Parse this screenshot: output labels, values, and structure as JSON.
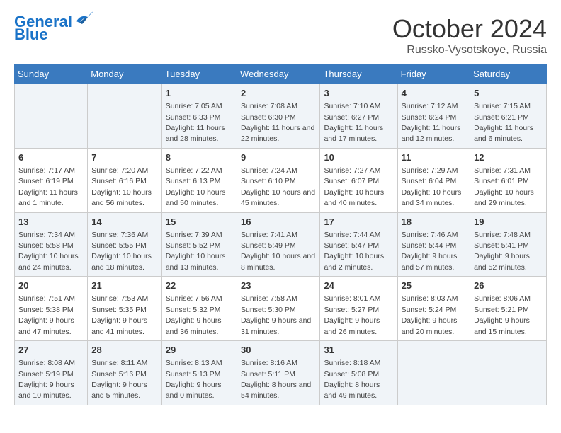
{
  "header": {
    "logo_line1": "General",
    "logo_line2": "Blue",
    "month": "October 2024",
    "location": "Russko-Vysotskoye, Russia"
  },
  "days_of_week": [
    "Sunday",
    "Monday",
    "Tuesday",
    "Wednesday",
    "Thursday",
    "Friday",
    "Saturday"
  ],
  "weeks": [
    [
      {
        "day": "",
        "info": ""
      },
      {
        "day": "",
        "info": ""
      },
      {
        "day": "1",
        "info": "Sunrise: 7:05 AM\nSunset: 6:33 PM\nDaylight: 11 hours and 28 minutes."
      },
      {
        "day": "2",
        "info": "Sunrise: 7:08 AM\nSunset: 6:30 PM\nDaylight: 11 hours and 22 minutes."
      },
      {
        "day": "3",
        "info": "Sunrise: 7:10 AM\nSunset: 6:27 PM\nDaylight: 11 hours and 17 minutes."
      },
      {
        "day": "4",
        "info": "Sunrise: 7:12 AM\nSunset: 6:24 PM\nDaylight: 11 hours and 12 minutes."
      },
      {
        "day": "5",
        "info": "Sunrise: 7:15 AM\nSunset: 6:21 PM\nDaylight: 11 hours and 6 minutes."
      }
    ],
    [
      {
        "day": "6",
        "info": "Sunrise: 7:17 AM\nSunset: 6:19 PM\nDaylight: 11 hours and 1 minute."
      },
      {
        "day": "7",
        "info": "Sunrise: 7:20 AM\nSunset: 6:16 PM\nDaylight: 10 hours and 56 minutes."
      },
      {
        "day": "8",
        "info": "Sunrise: 7:22 AM\nSunset: 6:13 PM\nDaylight: 10 hours and 50 minutes."
      },
      {
        "day": "9",
        "info": "Sunrise: 7:24 AM\nSunset: 6:10 PM\nDaylight: 10 hours and 45 minutes."
      },
      {
        "day": "10",
        "info": "Sunrise: 7:27 AM\nSunset: 6:07 PM\nDaylight: 10 hours and 40 minutes."
      },
      {
        "day": "11",
        "info": "Sunrise: 7:29 AM\nSunset: 6:04 PM\nDaylight: 10 hours and 34 minutes."
      },
      {
        "day": "12",
        "info": "Sunrise: 7:31 AM\nSunset: 6:01 PM\nDaylight: 10 hours and 29 minutes."
      }
    ],
    [
      {
        "day": "13",
        "info": "Sunrise: 7:34 AM\nSunset: 5:58 PM\nDaylight: 10 hours and 24 minutes."
      },
      {
        "day": "14",
        "info": "Sunrise: 7:36 AM\nSunset: 5:55 PM\nDaylight: 10 hours and 18 minutes."
      },
      {
        "day": "15",
        "info": "Sunrise: 7:39 AM\nSunset: 5:52 PM\nDaylight: 10 hours and 13 minutes."
      },
      {
        "day": "16",
        "info": "Sunrise: 7:41 AM\nSunset: 5:49 PM\nDaylight: 10 hours and 8 minutes."
      },
      {
        "day": "17",
        "info": "Sunrise: 7:44 AM\nSunset: 5:47 PM\nDaylight: 10 hours and 2 minutes."
      },
      {
        "day": "18",
        "info": "Sunrise: 7:46 AM\nSunset: 5:44 PM\nDaylight: 9 hours and 57 minutes."
      },
      {
        "day": "19",
        "info": "Sunrise: 7:48 AM\nSunset: 5:41 PM\nDaylight: 9 hours and 52 minutes."
      }
    ],
    [
      {
        "day": "20",
        "info": "Sunrise: 7:51 AM\nSunset: 5:38 PM\nDaylight: 9 hours and 47 minutes."
      },
      {
        "day": "21",
        "info": "Sunrise: 7:53 AM\nSunset: 5:35 PM\nDaylight: 9 hours and 41 minutes."
      },
      {
        "day": "22",
        "info": "Sunrise: 7:56 AM\nSunset: 5:32 PM\nDaylight: 9 hours and 36 minutes."
      },
      {
        "day": "23",
        "info": "Sunrise: 7:58 AM\nSunset: 5:30 PM\nDaylight: 9 hours and 31 minutes."
      },
      {
        "day": "24",
        "info": "Sunrise: 8:01 AM\nSunset: 5:27 PM\nDaylight: 9 hours and 26 minutes."
      },
      {
        "day": "25",
        "info": "Sunrise: 8:03 AM\nSunset: 5:24 PM\nDaylight: 9 hours and 20 minutes."
      },
      {
        "day": "26",
        "info": "Sunrise: 8:06 AM\nSunset: 5:21 PM\nDaylight: 9 hours and 15 minutes."
      }
    ],
    [
      {
        "day": "27",
        "info": "Sunrise: 8:08 AM\nSunset: 5:19 PM\nDaylight: 9 hours and 10 minutes."
      },
      {
        "day": "28",
        "info": "Sunrise: 8:11 AM\nSunset: 5:16 PM\nDaylight: 9 hours and 5 minutes."
      },
      {
        "day": "29",
        "info": "Sunrise: 8:13 AM\nSunset: 5:13 PM\nDaylight: 9 hours and 0 minutes."
      },
      {
        "day": "30",
        "info": "Sunrise: 8:16 AM\nSunset: 5:11 PM\nDaylight: 8 hours and 54 minutes."
      },
      {
        "day": "31",
        "info": "Sunrise: 8:18 AM\nSunset: 5:08 PM\nDaylight: 8 hours and 49 minutes."
      },
      {
        "day": "",
        "info": ""
      },
      {
        "day": "",
        "info": ""
      }
    ]
  ]
}
